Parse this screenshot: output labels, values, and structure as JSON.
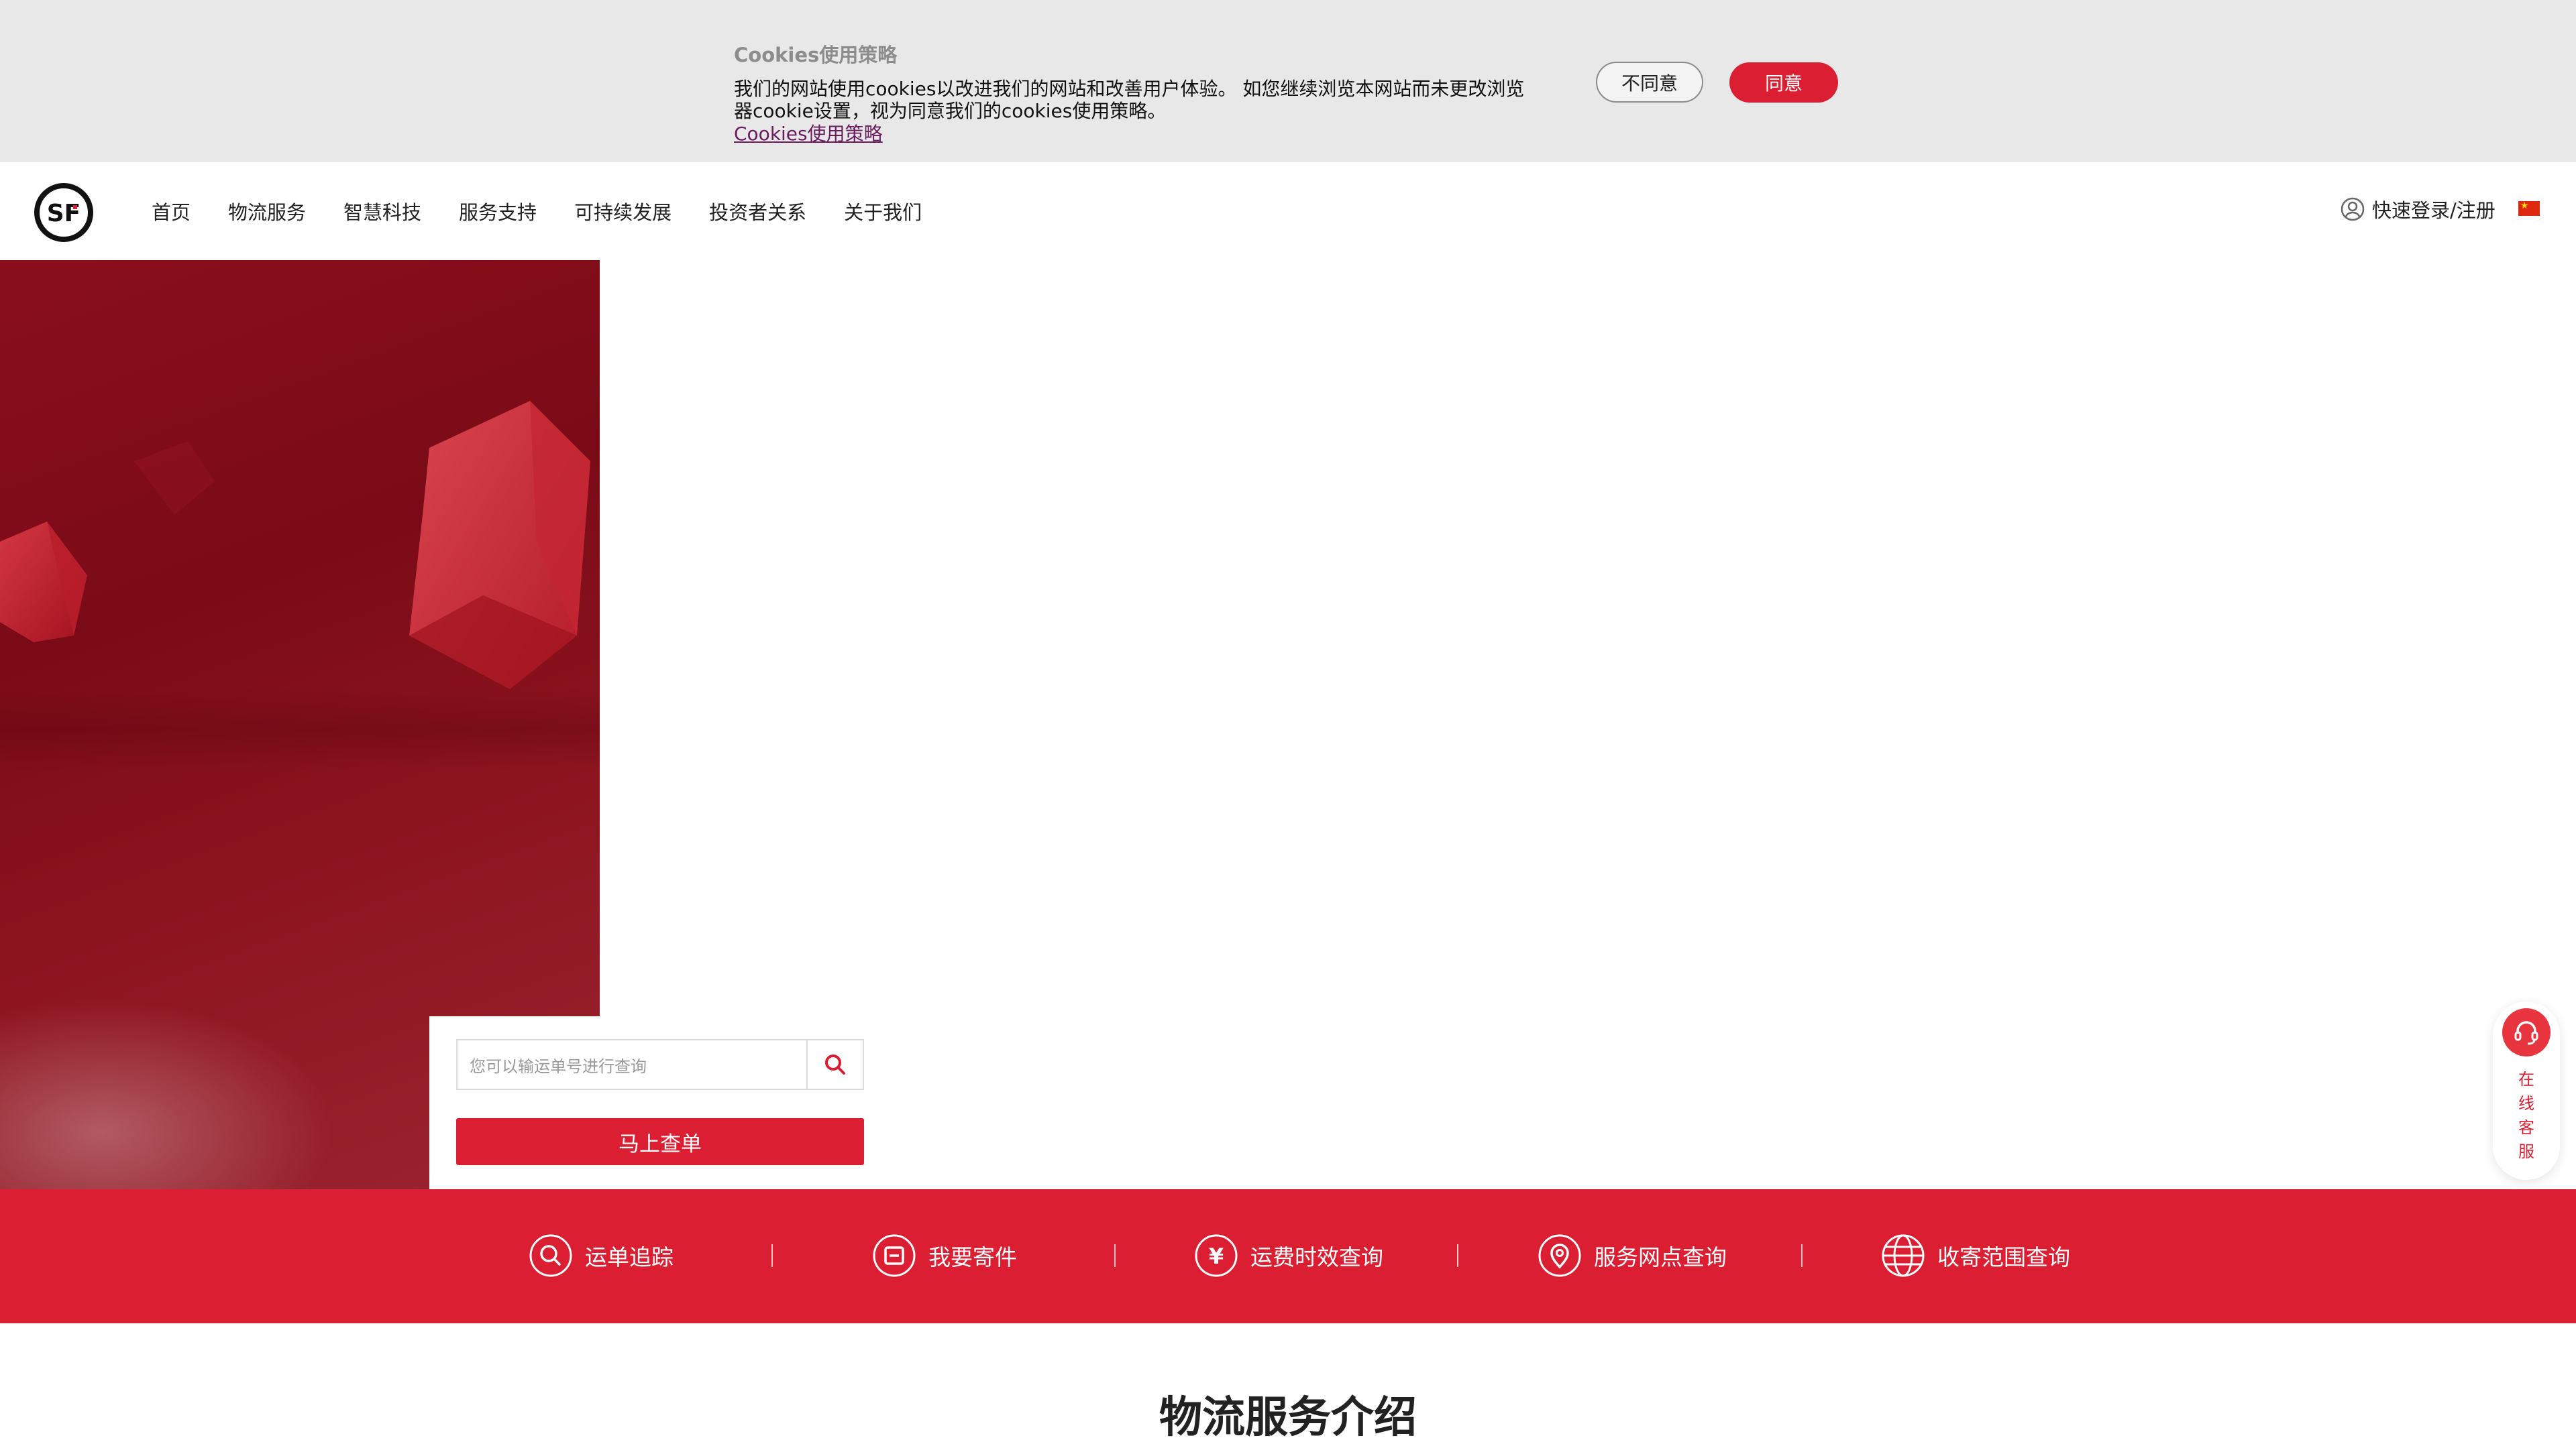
{
  "cookie": {
    "title": "Cookies使用策略",
    "body": "我们的网站使用cookies以改进我们的网站和改善用户体验。 如您继续浏览本网站而未更改浏览器cookie设置，视为同意我们的cookies使用策略。",
    "link": "Cookies使用策略",
    "disagree_label": "不同意",
    "agree_label": "同意"
  },
  "header": {
    "logo_text": "SF",
    "nav": [
      "首页",
      "物流服务",
      "智慧科技",
      "服务支持",
      "可持续发展",
      "投资者关系",
      "关于我们"
    ],
    "login_label": "快速登录/注册",
    "language_flag": "china-flag-icon"
  },
  "query": {
    "placeholder": "您可以输运单号进行查询",
    "submit_label": "马上查单"
  },
  "services": [
    {
      "label": "运单追踪",
      "icon": "search-circle-icon"
    },
    {
      "label": "我要寄件",
      "icon": "package-circle-icon"
    },
    {
      "label": "运费时效查询",
      "icon": "yen-circle-icon"
    },
    {
      "label": "服务网点查询",
      "icon": "location-pin-icon"
    },
    {
      "label": "收寄范围查询",
      "icon": "globe-icon"
    }
  ],
  "section": {
    "title": "物流服务介绍"
  },
  "float_service": {
    "chars": [
      "在",
      "线",
      "客",
      "服"
    ],
    "icon": "headset-icon"
  },
  "colors": {
    "brand_red": "#dc1e32",
    "cookie_bg": "#e8e8e8",
    "hero_red": "#7a0b16"
  }
}
